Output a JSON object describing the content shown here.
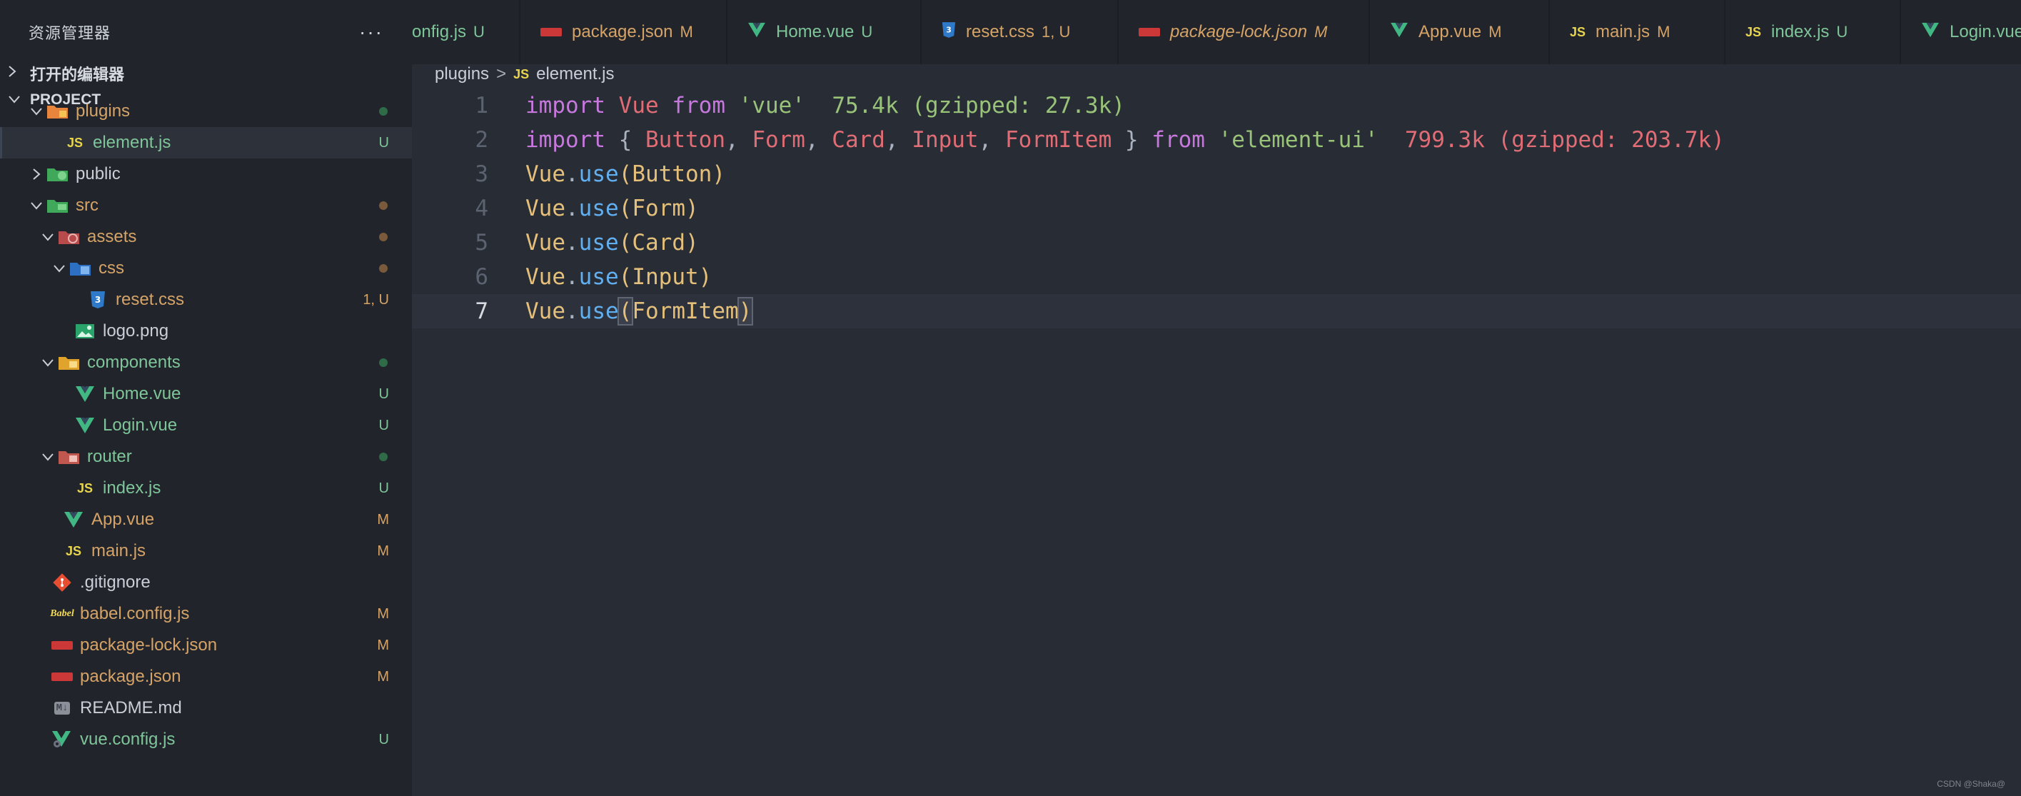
{
  "sidebar": {
    "title": "资源管理器",
    "more": "···",
    "open_editors": "打开的编辑器",
    "project": "PROJECT",
    "tree": [
      {
        "label": "plugins",
        "status": "",
        "color": "#d6a367",
        "icon": "folder-plugins-icon"
      },
      {
        "label": "element.js",
        "status": "U",
        "color": "#7ec699",
        "icon": "js-file-icon"
      },
      {
        "label": "public",
        "status": "",
        "color": "#c9ced8",
        "icon": "folder-public-icon"
      },
      {
        "label": "src",
        "status": "",
        "color": "#d6a367",
        "icon": "folder-src-icon"
      },
      {
        "label": "assets",
        "status": "",
        "color": "#d6a367",
        "icon": "folder-assets-icon"
      },
      {
        "label": "css",
        "status": "",
        "color": "#d6a367",
        "icon": "folder-css-icon"
      },
      {
        "label": "reset.css",
        "status": "1, U",
        "color": "#d6a367",
        "icon": "css-file-icon"
      },
      {
        "label": "logo.png",
        "status": "",
        "color": "#c9ced8",
        "icon": "image-file-icon"
      },
      {
        "label": "components",
        "status": "",
        "color": "#7ec699",
        "icon": "folder-components-icon"
      },
      {
        "label": "Home.vue",
        "status": "U",
        "color": "#7ec699",
        "icon": "vue-file-icon"
      },
      {
        "label": "Login.vue",
        "status": "U",
        "color": "#7ec699",
        "icon": "vue-file-icon"
      },
      {
        "label": "router",
        "status": "",
        "color": "#7ec699",
        "icon": "folder-router-icon"
      },
      {
        "label": "index.js",
        "status": "U",
        "color": "#7ec699",
        "icon": "js-file-icon"
      },
      {
        "label": "App.vue",
        "status": "M",
        "color": "#d6a367",
        "icon": "vue-file-icon"
      },
      {
        "label": "main.js",
        "status": "M",
        "color": "#d6a367",
        "icon": "js-file-icon"
      },
      {
        "label": ".gitignore",
        "status": "",
        "color": "#c9ced8",
        "icon": "git-file-icon"
      },
      {
        "label": "babel.config.js",
        "status": "M",
        "color": "#d6a367",
        "icon": "babel-file-icon"
      },
      {
        "label": "package-lock.json",
        "status": "M",
        "color": "#d6a367",
        "icon": "npm-file-icon"
      },
      {
        "label": "package.json",
        "status": "M",
        "color": "#d6a367",
        "icon": "npm-file-icon"
      },
      {
        "label": "README.md",
        "status": "",
        "color": "#c9ced8",
        "icon": "markdown-file-icon"
      },
      {
        "label": "vue.config.js",
        "status": "U",
        "color": "#7ec699",
        "icon": "vue-config-file-icon"
      }
    ]
  },
  "tabs": [
    {
      "name": "onfig.js",
      "status": "U",
      "color": "#7ec699",
      "icon": "babel-file-icon"
    },
    {
      "name": "package.json",
      "status": "M",
      "color": "#d6a367",
      "icon": "npm-file-icon"
    },
    {
      "name": "Home.vue",
      "status": "U",
      "color": "#7ec699",
      "icon": "vue-file-icon"
    },
    {
      "name": "reset.css",
      "status": "1, U",
      "color": "#d6a367",
      "icon": "css-file-icon"
    },
    {
      "name": "package-lock.json",
      "status": "M",
      "color": "#d6a367",
      "icon": "npm-file-icon"
    },
    {
      "name": "App.vue",
      "status": "M",
      "color": "#d6a367",
      "icon": "vue-file-icon"
    },
    {
      "name": "main.js",
      "status": "M",
      "color": "#d6a367",
      "icon": "js-file-icon"
    },
    {
      "name": "index.js",
      "status": "U",
      "color": "#7ec699",
      "icon": "js-file-icon"
    },
    {
      "name": "Login.vue",
      "status": "",
      "color": "#7ec699",
      "icon": "vue-file-icon"
    }
  ],
  "breadcrumb": {
    "folder": "plugins",
    "sep": ">",
    "file_badge": "JS",
    "file": "element.js"
  },
  "code": {
    "line_numbers": [
      "1",
      "2",
      "3",
      "4",
      "5",
      "6",
      "7"
    ],
    "line1": {
      "kw1": "import",
      "obj": "Vue",
      "kw2": "from",
      "str": "'vue'",
      "hint": "75.4k (gzipped: 27.3k)"
    },
    "line2": {
      "kw1": "import",
      "open": "{",
      "items": [
        "Button",
        "Form",
        "Card",
        "Input",
        "FormItem"
      ],
      "close": "}",
      "kw2": "from",
      "str": "'element-ui'",
      "hint": "799.3k (gzipped: 203.7k)"
    },
    "uses": [
      "Button",
      "Form",
      "Card",
      "Input",
      "FormItem"
    ],
    "obj": "Vue",
    "method": "use"
  },
  "watermark": "CSDN @Shaka@"
}
